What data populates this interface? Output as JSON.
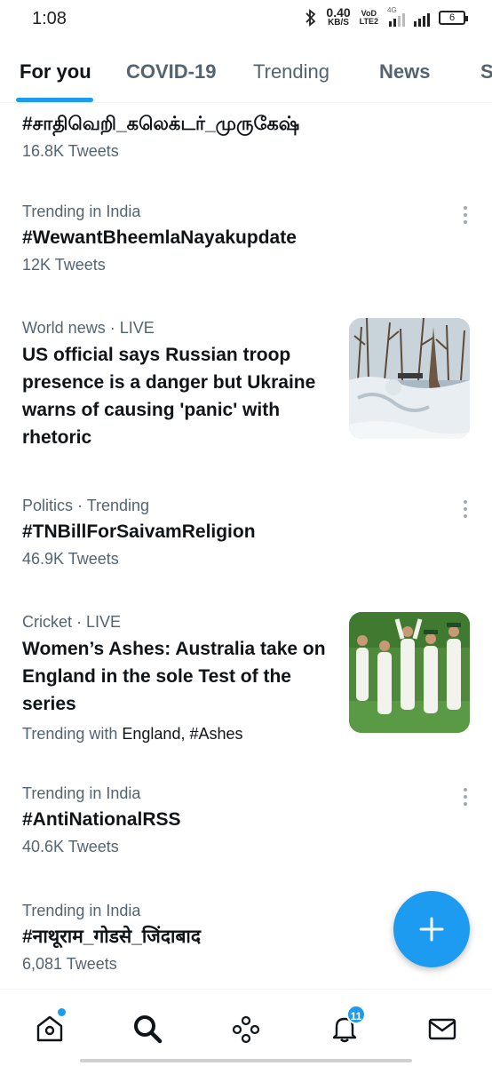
{
  "status_bar": {
    "time": "1:08",
    "net_speed_value": "0.40",
    "net_speed_unit": "KB/S",
    "volte_top": "VoD",
    "volte_bottom": "LTE2",
    "network_label": "4G",
    "battery": "6"
  },
  "tabs": [
    {
      "label": "For you",
      "active": true
    },
    {
      "label": "COVID-19",
      "active": false
    },
    {
      "label": "Trending",
      "active": false
    },
    {
      "label": "News",
      "active": false
    },
    {
      "label": "S",
      "active": false
    }
  ],
  "trends": [
    {
      "topic": "#சாதிவெறி_கலெக்டர்_முருகேஷ்",
      "count": "16.8K Tweets"
    },
    {
      "context": "Trending in India",
      "topic": "#WewantBheemlaNayakupdate",
      "count": "12K Tweets"
    },
    {
      "category": "World news",
      "separator": " · ",
      "status": "LIVE",
      "headline": "US official says Russian troop presence is a danger but Ukraine warns of causing 'panic' with rhetoric"
    },
    {
      "category": "Politics",
      "separator": " · ",
      "status": "Trending",
      "topic": "#TNBillForSaivamReligion",
      "count": "46.9K Tweets"
    },
    {
      "category": "Cricket",
      "separator": " · ",
      "status": "LIVE",
      "headline": "Women’s Ashes: Australia take on England in the sole Test of the series",
      "trending_with_label": "Trending with ",
      "trending_with_tags": "England, #Ashes"
    },
    {
      "context": "Trending in India",
      "topic": "#AntiNationalRSS",
      "count": "40.6K Tweets"
    },
    {
      "context": "Trending in India",
      "topic": "#नाथूराम_गोडसे_जिंदाबाद",
      "count": "6,081 Tweets"
    }
  ],
  "bottom_nav": {
    "items": [
      {
        "icon": "home-icon",
        "badge": "dot"
      },
      {
        "icon": "search-icon",
        "active": true
      },
      {
        "icon": "spaces-icon"
      },
      {
        "icon": "bell-icon",
        "badge": "11"
      },
      {
        "icon": "mail-icon"
      }
    ],
    "notification_count": "11"
  },
  "colors": {
    "accent": "#1d9bf0",
    "text_primary": "#0f1419",
    "text_secondary": "#536471"
  }
}
